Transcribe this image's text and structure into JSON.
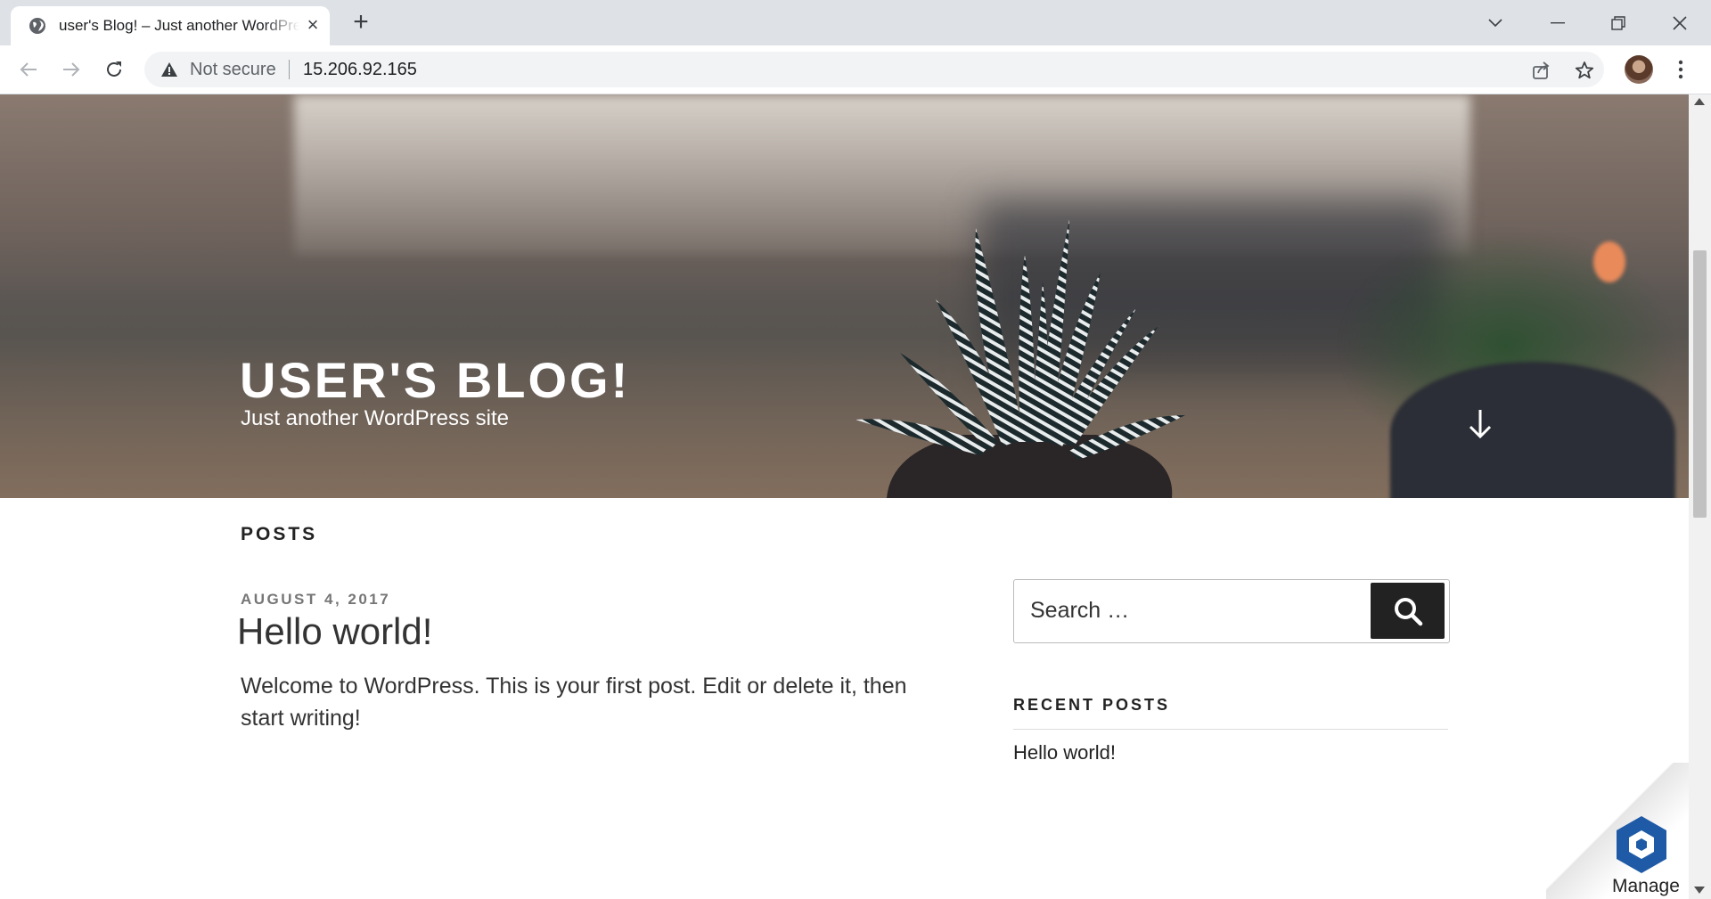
{
  "browser": {
    "tab": {
      "title": "user's Blog! – Just another WordPress site",
      "close_label": "×"
    },
    "new_tab_label": "+",
    "omnibox": {
      "security_label": "Not secure",
      "url": "15.206.92.165"
    }
  },
  "hero": {
    "site_title": "USER'S BLOG!",
    "site_description": "Just another WordPress site"
  },
  "main": {
    "section_heading": "POSTS",
    "post": {
      "date": "AUGUST 4, 2017",
      "title": "Hello world!",
      "excerpt": "Welcome to WordPress. This is your first post. Edit or delete it, then start writing!"
    }
  },
  "sidebar": {
    "search": {
      "placeholder": "Search …"
    },
    "recent_posts_heading": "RECENT POSTS",
    "recent_posts": [
      "Hello world!"
    ]
  },
  "manage_badge": {
    "label": "Manage"
  },
  "colors": {
    "tabstrip": "#dee1e6",
    "omnibox": "#f1f3f4",
    "search_button": "#222222",
    "manage_logo": "#1f5aa6"
  }
}
